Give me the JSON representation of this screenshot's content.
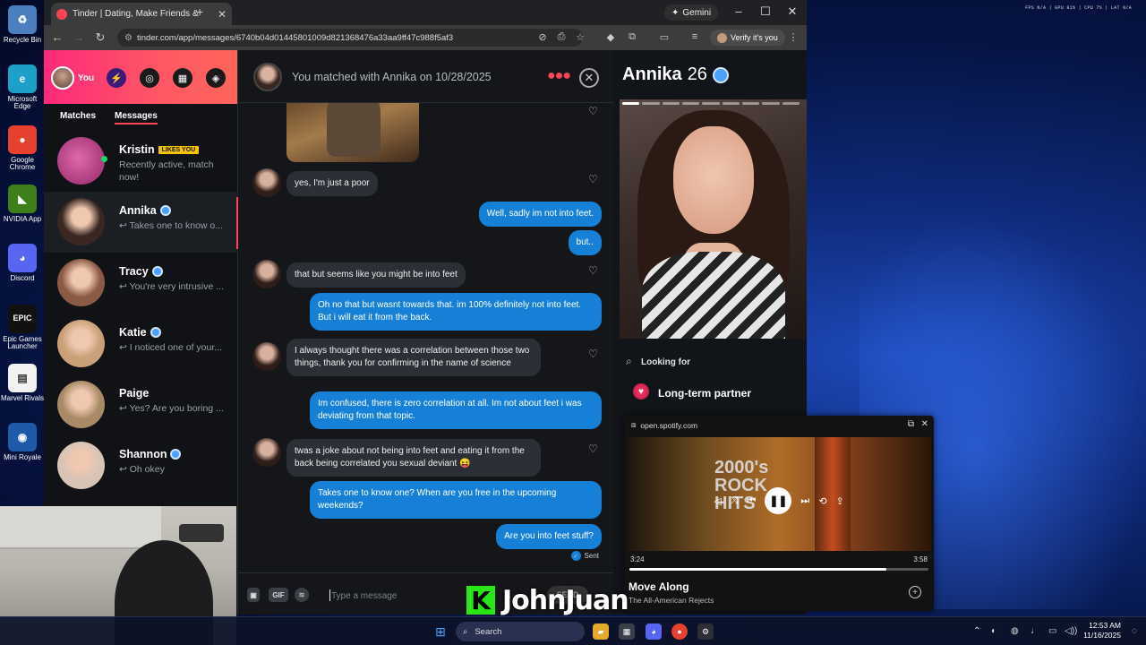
{
  "desktop": {
    "icons": [
      {
        "label": "Recycle Bin",
        "glyph": "♻",
        "color": "#4c7fbf"
      },
      {
        "label": "Microsoft Edge",
        "glyph": "e",
        "color": "#1da0c8"
      },
      {
        "label": "Google Chrome",
        "glyph": "●",
        "color": "#e6412e"
      },
      {
        "label": "NVIDIA App",
        "glyph": "◣",
        "color": "#3f7f1b"
      },
      {
        "label": "Discord",
        "glyph": "◕",
        "color": "#5865f2"
      },
      {
        "label": "Epic Games Launcher",
        "glyph": "EPIC",
        "color": "#111111"
      },
      {
        "label": "Marvel Rivals",
        "glyph": "▤",
        "color": "#f2f2f2"
      },
      {
        "label": "Mini Royale",
        "glyph": "◉",
        "color": "#1e5aa8"
      }
    ],
    "perf_overlay": "FPS N/A  |  GPU 81%  |  CPU 7%  |  LAT N/A"
  },
  "browser": {
    "tab_title": "Tinder | Dating, Make Friends &",
    "new_tab": "+",
    "gemini_label": "Gemini",
    "url": "tinder.com/app/messages/6740b04d01445801009d821368476a33aa9ff47c988f5af3",
    "verify_label": "Verify it's you"
  },
  "tinder": {
    "you_label": "You",
    "tabs": {
      "matches": "Matches",
      "messages": "Messages"
    },
    "conversations": [
      {
        "name": "Kristin",
        "badge": "LIKES YOU",
        "preview": "Recently active, match now!",
        "verified": false,
        "active": true,
        "color": "#c74a8c"
      },
      {
        "name": "Annika",
        "badge": "",
        "preview": "↩ Takes one to know o...",
        "verified": true,
        "active": false,
        "color": "#3a2722"
      },
      {
        "name": "Tracy",
        "badge": "",
        "preview": "↩ You're very intrusive ...",
        "verified": true,
        "active": false,
        "color": "#8a5a44"
      },
      {
        "name": "Katie",
        "badge": "",
        "preview": "↩ I noticed one of your...",
        "verified": true,
        "active": false,
        "color": "#c9a078"
      },
      {
        "name": "Paige",
        "badge": "",
        "preview": "↩ Yes? Are you boring ...",
        "verified": false,
        "active": false,
        "color": "#a88a66"
      },
      {
        "name": "Shannon",
        "badge": "",
        "preview": "↩ Oh okey",
        "verified": true,
        "active": false,
        "color": "#d8c4b6"
      }
    ],
    "chat": {
      "header": "You matched with Annika on 10/28/2025",
      "messages": [
        {
          "dir": "in",
          "text": "yes, I'm just a poor"
        },
        {
          "dir": "out",
          "text": "Well, sadly im not into feet."
        },
        {
          "dir": "out",
          "text": "but.."
        },
        {
          "dir": "in",
          "text": "that but seems like you might be into feet"
        },
        {
          "dir": "out",
          "text": "Oh no that but wasnt towards that. im 100% definitely not into feet. But i will eat it from the back."
        },
        {
          "dir": "in",
          "text": "I always thought there was a correlation between those two things, thank you for confirming in the name of science"
        },
        {
          "dir": "out",
          "text": "Im confused, there is zero correlation at all. Im not about feet i was deviating from that topic."
        },
        {
          "dir": "in",
          "text": "twas a joke about not being into feet and eating it from the back being correlated you sexual deviant 😝"
        },
        {
          "dir": "out",
          "text": "Takes one to know one? When are you free in the upcoming weekends?"
        },
        {
          "dir": "out",
          "text": "Are you into feet stuff?"
        }
      ],
      "sent_label": "Sent",
      "composer": {
        "gif_label": "GIF",
        "placeholder": "Type a message",
        "send_label": "SEND"
      }
    },
    "profile": {
      "name": "Annika",
      "age": "26",
      "photo_count": 9,
      "looking_for_label": "Looking for",
      "looking_for_value": "Long-term partner"
    }
  },
  "spotify_pip": {
    "source": "open.spotify.com",
    "art_text": "2000's ROCK HITS",
    "time_current": "3:24",
    "time_total": "3:58",
    "progress": 0.86,
    "song": "Move Along",
    "artist": "The All-American Rejects"
  },
  "watermark": {
    "letter": "K",
    "name": "JohnJuan"
  },
  "taskbar": {
    "search_label": "Search",
    "clock_time": "12:53 AM",
    "clock_date": "11/16/2025"
  }
}
